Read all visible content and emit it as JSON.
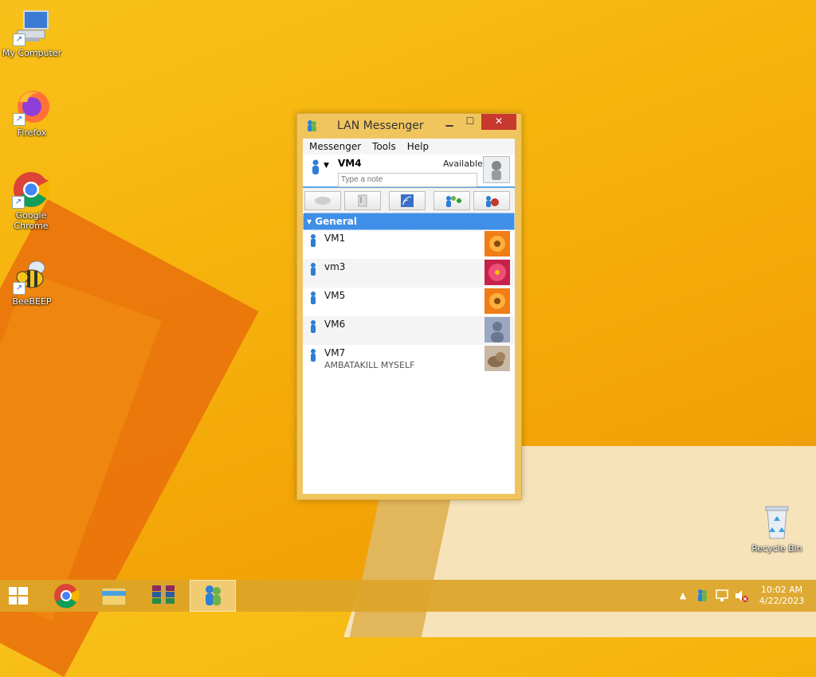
{
  "desktop": {
    "icons": [
      {
        "label": "My Computer"
      },
      {
        "label": "Firefox"
      },
      {
        "label": "Google Chrome"
      },
      {
        "label": "BeeBEEP"
      },
      {
        "label": "Recycle Bin"
      }
    ]
  },
  "window": {
    "title": "LAN Messenger",
    "menus": [
      "Messenger",
      "Tools",
      "Help"
    ],
    "user": {
      "name": "VM4",
      "status": "Available",
      "note_placeholder": "Type a note"
    },
    "toolbar_icons": [
      "chat-icon",
      "attach-icon",
      "broadcast-icon",
      "add-contact-icon",
      "settings-icon"
    ],
    "group": {
      "name": "General"
    },
    "contacts": [
      {
        "name": "VM1",
        "note": ""
      },
      {
        "name": "vm3",
        "note": ""
      },
      {
        "name": "VM5",
        "note": ""
      },
      {
        "name": "VM6",
        "note": ""
      },
      {
        "name": "VM7",
        "note": "AMBATAKILL MYSELF"
      }
    ]
  },
  "taskbar": {
    "clock": {
      "time": "10:02 AM",
      "date": "4/22/2023"
    }
  },
  "colors": {
    "accent": "#3f8fe8",
    "close": "#c7382e",
    "desktop": "#f6b40d"
  }
}
